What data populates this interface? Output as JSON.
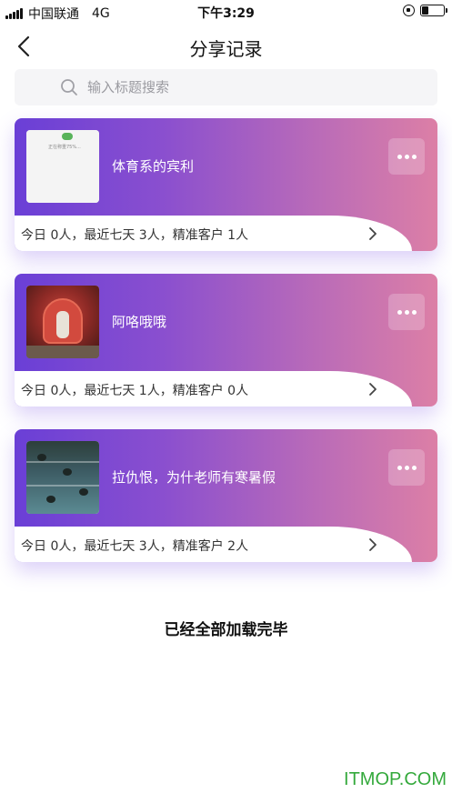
{
  "status_bar": {
    "carrier": "中国联通",
    "network": "4G",
    "time": "下午3:29"
  },
  "nav": {
    "title": "分享记录",
    "back_icon": "chevron-left-icon"
  },
  "search": {
    "placeholder": "输入标题搜索",
    "icon": "search-icon"
  },
  "cards": [
    {
      "title": "体育系的宾利",
      "stats": "今日 0人，最近七天 3人，精准客户 1人",
      "thumbnail": "scale-screenshot",
      "thumb_caption": "正在称重75%..."
    },
    {
      "title": "阿咯哦哦",
      "stats": "今日 0人，最近七天 1人，精准客户 0人",
      "thumbnail": "stage-photo"
    },
    {
      "title": "拉仇恨，为什老师有寒暑假",
      "stats": "今日 0人，最近七天 3人，精准客户 2人",
      "thumbnail": "pool-photo"
    }
  ],
  "footer": {
    "text": "已经全部加载完毕"
  },
  "watermark": "ITMOP.COM",
  "colors": {
    "card_gradient_start": "#6a3fd6",
    "card_gradient_end": "#dc7fa6",
    "watermark": "#34a93c"
  }
}
